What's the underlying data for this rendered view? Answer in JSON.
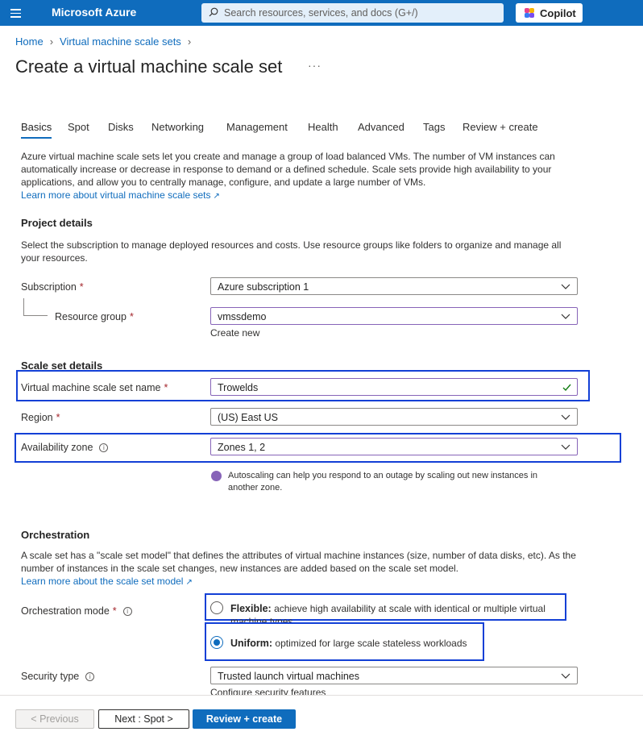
{
  "topbar": {
    "brand": "Microsoft Azure",
    "search_placeholder": "Search resources, services, and docs (G+/)",
    "copilot_label": "Copilot"
  },
  "breadcrumb": [
    "Home",
    "Virtual machine scale sets"
  ],
  "page": {
    "title": "Create a virtual machine scale set",
    "more": "···"
  },
  "tabs": [
    "Basics",
    "Spot",
    "Disks",
    "Networking",
    "Management",
    "Health",
    "Advanced",
    "Tags",
    "Review + create"
  ],
  "intro": {
    "text": "Azure virtual machine scale sets let you create and manage a group of load balanced VMs. The number of VM instances can automatically increase or decrease in response to demand or a defined schedule. Scale sets provide high availability to your applications, and allow you to centrally manage, configure, and update a large number of VMs.",
    "link": "Learn more about virtual machine scale sets"
  },
  "project": {
    "heading": "Project details",
    "text": "Select the subscription to manage deployed resources and costs. Use resource groups like folders to organize and manage all your resources.",
    "subscription_label": "Subscription",
    "subscription_value": "Azure subscription 1",
    "rg_label": "Resource group",
    "rg_value": "vmssdemo",
    "create_new": "Create new"
  },
  "scaleset": {
    "heading": "Scale set details",
    "name_label": "Virtual machine scale set name",
    "name_value": "Trowelds",
    "region_label": "Region",
    "region_value": "(US) East US",
    "zone_label": "Availability zone",
    "zone_value": "Zones 1, 2",
    "note": "Autoscaling can help you respond to an outage by scaling out new instances in another zone."
  },
  "orchestration": {
    "heading": "Orchestration",
    "text": "A scale set has a \"scale set model\" that defines the attributes of virtual machine instances (size, number of data disks, etc). As the number of instances in the scale set changes, new instances are added based on the scale set model.",
    "link": "Learn more about the scale set model",
    "mode_label": "Orchestration mode",
    "flexible_title": "Flexible:",
    "flexible_desc": "achieve high availability at scale with identical or multiple virtual machine types",
    "uniform_title": "Uniform:",
    "uniform_desc": "optimized for large scale stateless workloads",
    "selected": "Uniform"
  },
  "security": {
    "label": "Security type",
    "value": "Trusted launch virtual machines",
    "link": "Configure security features"
  },
  "footer": {
    "previous": "< Previous",
    "next": "Next : Spot >",
    "create": "Review + create"
  },
  "colors": {
    "accent": "#0f6cbd",
    "highlight": "#1340d6",
    "required": "#a4262c"
  }
}
